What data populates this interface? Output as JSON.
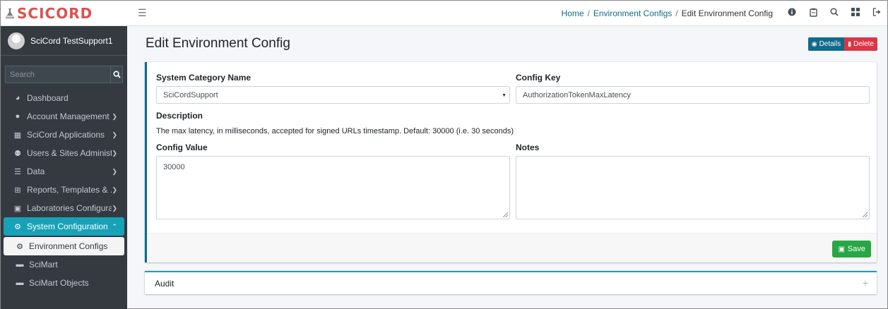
{
  "brand": {
    "name": "SCICORD",
    "icon": "flask-icon"
  },
  "user": {
    "name": "SciCord TestSupport1"
  },
  "sidebar": {
    "search_placeholder": "Search",
    "items": [
      {
        "label": "Dashboard",
        "icon": "dashboard-icon"
      },
      {
        "label": "Account Management",
        "icon": "user-circle-icon",
        "has_chevron": true
      },
      {
        "label": "SciCord Applications",
        "icon": "windows-icon",
        "has_chevron": true
      },
      {
        "label": "Users & Sites Administ...",
        "icon": "users-icon",
        "has_chevron": true
      },
      {
        "label": "Data",
        "icon": "database-icon",
        "has_chevron": true
      },
      {
        "label": "Reports, Templates & ...",
        "icon": "table-icon",
        "has_chevron": true
      },
      {
        "label": "Laboratories Configura...",
        "icon": "clipboard-check-icon",
        "has_chevron": true
      },
      {
        "label": "System Configuration",
        "icon": "cogs-icon",
        "has_chevron": true,
        "active": true
      },
      {
        "label": "Environment Configs",
        "icon": "cogs-icon",
        "sub": true,
        "selected": true
      },
      {
        "label": "SciMart",
        "icon": "folder-icon",
        "sub": true
      },
      {
        "label": "SciMart Objects",
        "icon": "folder-icon",
        "sub": true
      }
    ]
  },
  "topbar": {
    "breadcrumb": {
      "home": "Home",
      "section": "Environment Configs",
      "current": "Edit Environment Config",
      "separator": "/"
    },
    "icons": [
      "info-icon",
      "clipboard-icon",
      "search-icon",
      "grid-icon",
      "logout-icon"
    ]
  },
  "page": {
    "title": "Edit Environment Config",
    "details_label": "Details",
    "delete_label": "Delete"
  },
  "form": {
    "category_label": "System Category Name",
    "category_value": "SciCordSupport",
    "key_label": "Config Key",
    "key_value": "AuthorizationTokenMaxLatency",
    "description_label": "Description",
    "description_text": "The max latency, in milliseconds, accepted for signed URLs timestamp. Default: 30000 (i.e. 30 seconds)",
    "value_label": "Config Value",
    "value_value": "30000",
    "notes_label": "Notes",
    "notes_value": "",
    "save_label": "Save"
  },
  "audit": {
    "title": "Audit",
    "expand_symbol": "+"
  },
  "colors": {
    "primary": "#0f6b8a",
    "accent": "#17a2b8",
    "danger": "#dc3545",
    "success": "#28a745",
    "sidebar": "#343a40"
  }
}
